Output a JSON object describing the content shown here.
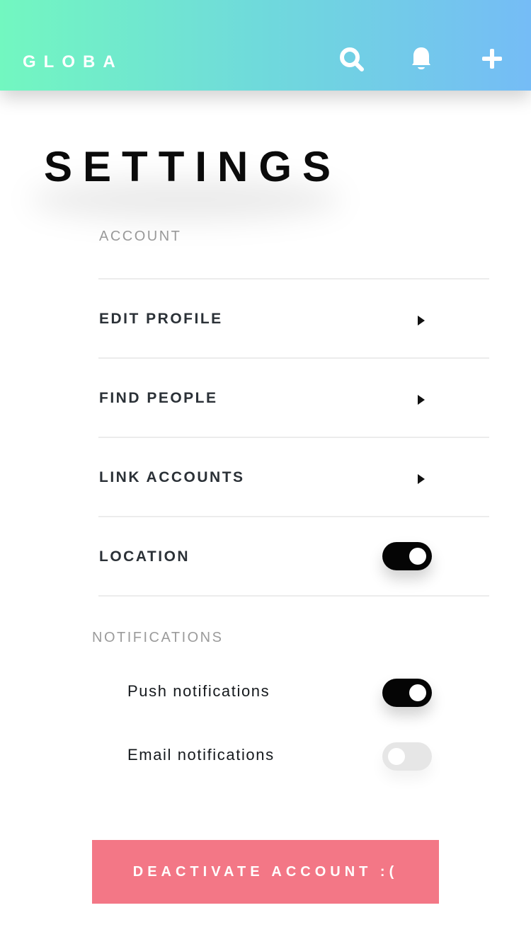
{
  "app": {
    "brand": "GLOBA"
  },
  "header": {
    "actions": [
      {
        "icon": "search-icon"
      },
      {
        "icon": "bell-icon"
      },
      {
        "icon": "plus-icon"
      }
    ]
  },
  "page": {
    "title": "SETTINGS"
  },
  "account": {
    "section_label": "ACCOUNT",
    "items": [
      {
        "label": "EDIT PROFILE",
        "icon": "chevron-right-icon"
      },
      {
        "label": "FIND PEOPLE",
        "icon": "chevron-right-icon"
      },
      {
        "label": "LINK ACCOUNTS",
        "icon": "chevron-right-icon"
      },
      {
        "label": "LOCATION",
        "toggle": true
      }
    ]
  },
  "notifications": {
    "section_label": "NOTIFICATIONS",
    "items": [
      {
        "label": "Push notifications",
        "toggle": true
      },
      {
        "label": "Email notifications",
        "toggle": false
      }
    ]
  },
  "actions": {
    "deactivate_label": "DEACTIVATE ACCOUNT :("
  },
  "colors": {
    "header_gradient_start": "#72f7c0",
    "header_gradient_end": "#75bcf6",
    "toggle_on": "#050505",
    "toggle_off": "#e6e6e6",
    "danger": "#f37786"
  }
}
